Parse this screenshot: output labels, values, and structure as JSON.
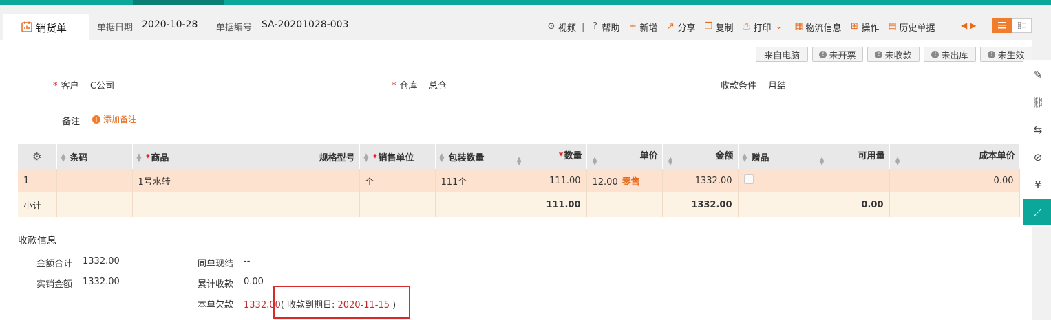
{
  "tab": {
    "title": "销货单"
  },
  "header": {
    "date_label": "单据日期",
    "date_value": "2020-10-28",
    "no_label": "单据编号",
    "no_value": "SA-20201028-003"
  },
  "toolbar": {
    "video": "视频",
    "help": "帮助",
    "add": "新增",
    "share": "分享",
    "copy": "复制",
    "print": "打印",
    "logistics": "物流信息",
    "operate": "操作",
    "history": "历史单据"
  },
  "status_tags": {
    "from_pc": "来自电脑",
    "not_invoiced": "未开票",
    "not_collected": "未收款",
    "not_shipped": "未出库",
    "not_effective": "未生效"
  },
  "form": {
    "customer_label": "客户",
    "customer_value": "C公司",
    "warehouse_label": "仓库",
    "warehouse_value": "总仓",
    "terms_label": "收款条件",
    "terms_value": "月结",
    "note_label": "备注",
    "add_note": "添加备注"
  },
  "table": {
    "headers": {
      "barcode": "条码",
      "product": "商品",
      "spec": "规格型号",
      "unit": "销售单位",
      "pack_qty": "包装数量",
      "qty": "数量",
      "price": "单价",
      "amount": "金额",
      "gift": "赠品",
      "available": "可用量",
      "cost": "成本单价"
    },
    "row": {
      "index": "1",
      "barcode": "",
      "product": "1号水转",
      "spec": "",
      "unit": "个",
      "pack_qty": "111个",
      "qty": "111.00",
      "price": "12.00",
      "price_tag": "零售",
      "amount": "1332.00",
      "available": "",
      "cost": "0.00"
    },
    "subtotal": {
      "label": "小计",
      "qty": "111.00",
      "amount": "1332.00",
      "available": "0.00"
    }
  },
  "payment": {
    "section_title": "收款信息",
    "total_label": "金额合计",
    "total_value": "1332.00",
    "actual_label": "实销金额",
    "actual_value": "1332.00",
    "cash_label": "同单现结",
    "cash_value": "--",
    "cum_label": "累计收款",
    "cum_value": "0.00",
    "owe_label": "本单欠款",
    "owe_value": "1332.00",
    "due_open": "( 收款到期日: ",
    "due_date": "2020-11-15",
    "due_close": " )"
  },
  "colors": {
    "teal": "#0aa79a",
    "orange": "#ef7d2d",
    "row_highlight": "#fde3cf",
    "due_red": "#c02b2b"
  }
}
